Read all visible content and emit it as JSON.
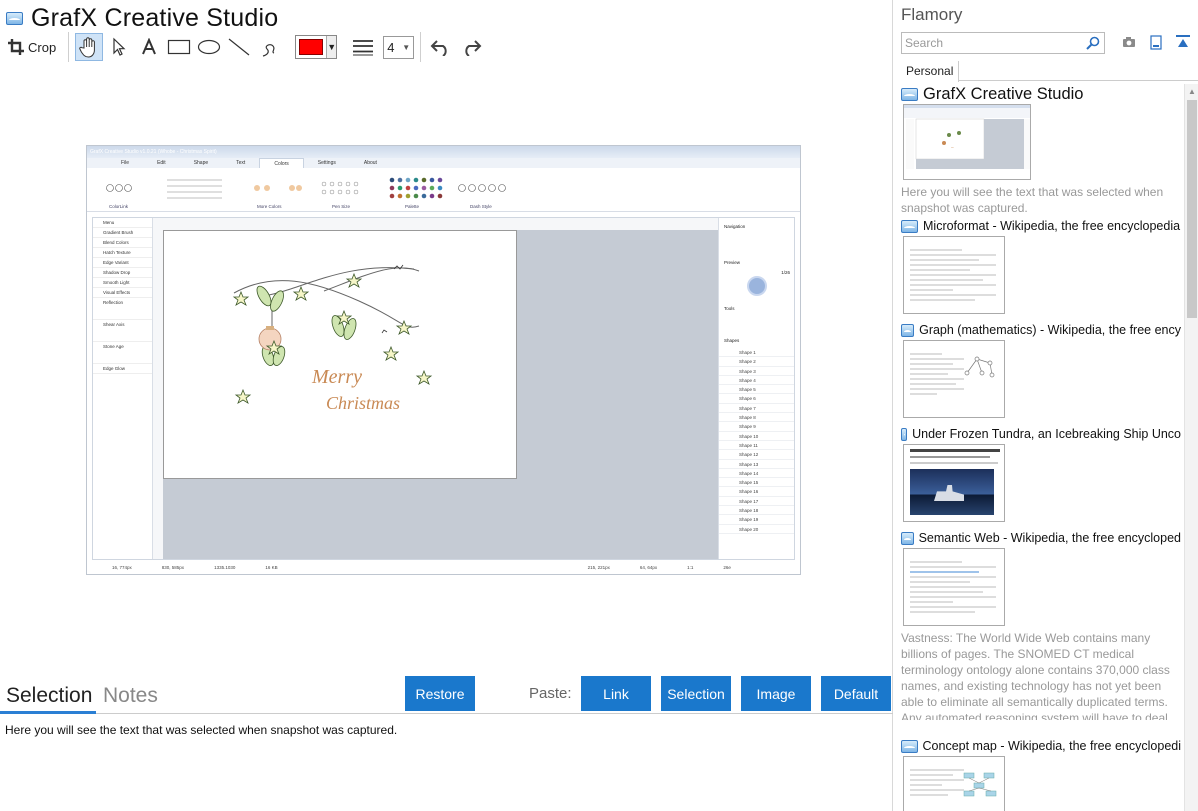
{
  "app": {
    "title": "GrafX Creative Studio"
  },
  "toolbar": {
    "crop_label": "Crop",
    "line_width_value": "4",
    "color_value": "#ff0000"
  },
  "screenshot": {
    "window_title": "GrafX Creative Studio v1.0.21 (Whobe - Christmas Spirit)",
    "menu_tabs": [
      "File",
      "Edit",
      "Shape",
      "Text",
      "Colors",
      "Settings",
      "About"
    ],
    "active_menu": "Colors",
    "ribbon_groups": [
      "ColorLink",
      "More Colors",
      "Pen Size",
      "Palette",
      "Dash Style"
    ],
    "left_items": [
      "Menu",
      "Gradient Brush",
      "Blend Colors",
      "Hatch Texture",
      "Edge Variant",
      "Shadow Drop",
      "Smooth Light",
      "Visual Effects",
      "Reflection",
      "Shear Axis",
      "Stone Age",
      "Edge Glow"
    ],
    "right_sections": [
      "Navigation",
      "Preview",
      "Tools",
      "Shapes"
    ],
    "preview_value": "1/26",
    "shapes": [
      "Shape 1",
      "Shape 2",
      "Shape 3",
      "Shape 4",
      "Shape 5",
      "Shape 6",
      "Shape 7",
      "Shape 8",
      "Shape 9",
      "Shape 10",
      "Shape 11",
      "Shape 12",
      "Shape 13",
      "Shape 14",
      "Shape 15",
      "Shape 16",
      "Shape 17",
      "Shape 18",
      "Shape 19",
      "Shape 20"
    ],
    "card_text_1": "Merry",
    "card_text_2": "Christmas",
    "status": [
      "16, 774px",
      "830, 585px",
      "1335.1030",
      "16 KB",
      "215, 221px",
      "64, 64px",
      "1:1",
      "26e"
    ]
  },
  "bottom": {
    "tab_selection": "Selection",
    "tab_notes": "Notes",
    "restore_label": "Restore",
    "paste_label": "Paste:",
    "paste_link": "Link",
    "paste_selection": "Selection",
    "paste_image": "Image",
    "paste_default": "Default",
    "selection_text": "Here you will see the text that was selected when snapshot was captured."
  },
  "pane": {
    "title": "Flamory",
    "search_placeholder": "Search",
    "tab_personal": "Personal",
    "items": [
      {
        "title": "GrafX Creative Studio",
        "desc": "Here you will see the text that was selected when snapshot was captured."
      },
      {
        "title": "Microformat - Wikipedia, the free encyclopedia",
        "desc": ""
      },
      {
        "title": "Graph (mathematics) - Wikipedia, the free ency",
        "desc": ""
      },
      {
        "title": "Under Frozen Tundra, an Icebreaking Ship Unco",
        "desc": ""
      },
      {
        "title": "Semantic Web - Wikipedia, the free encycloped",
        "desc": "Vastness: The World Wide Web contains many billions of pages. The SNOMED CT medical terminology ontology alone contains 370,000 class names, and existing technology has not yet been able to eliminate all semantically duplicated terms. Any automated reasoning system will have to deal with truly huge inputs."
      },
      {
        "title": "Concept map - Wikipedia, the free encyclopedi",
        "desc": ""
      }
    ]
  },
  "colors": {
    "accent": "#1a78cc",
    "tab_underline": "#2a7fd4",
    "muted_text": "#999999"
  }
}
